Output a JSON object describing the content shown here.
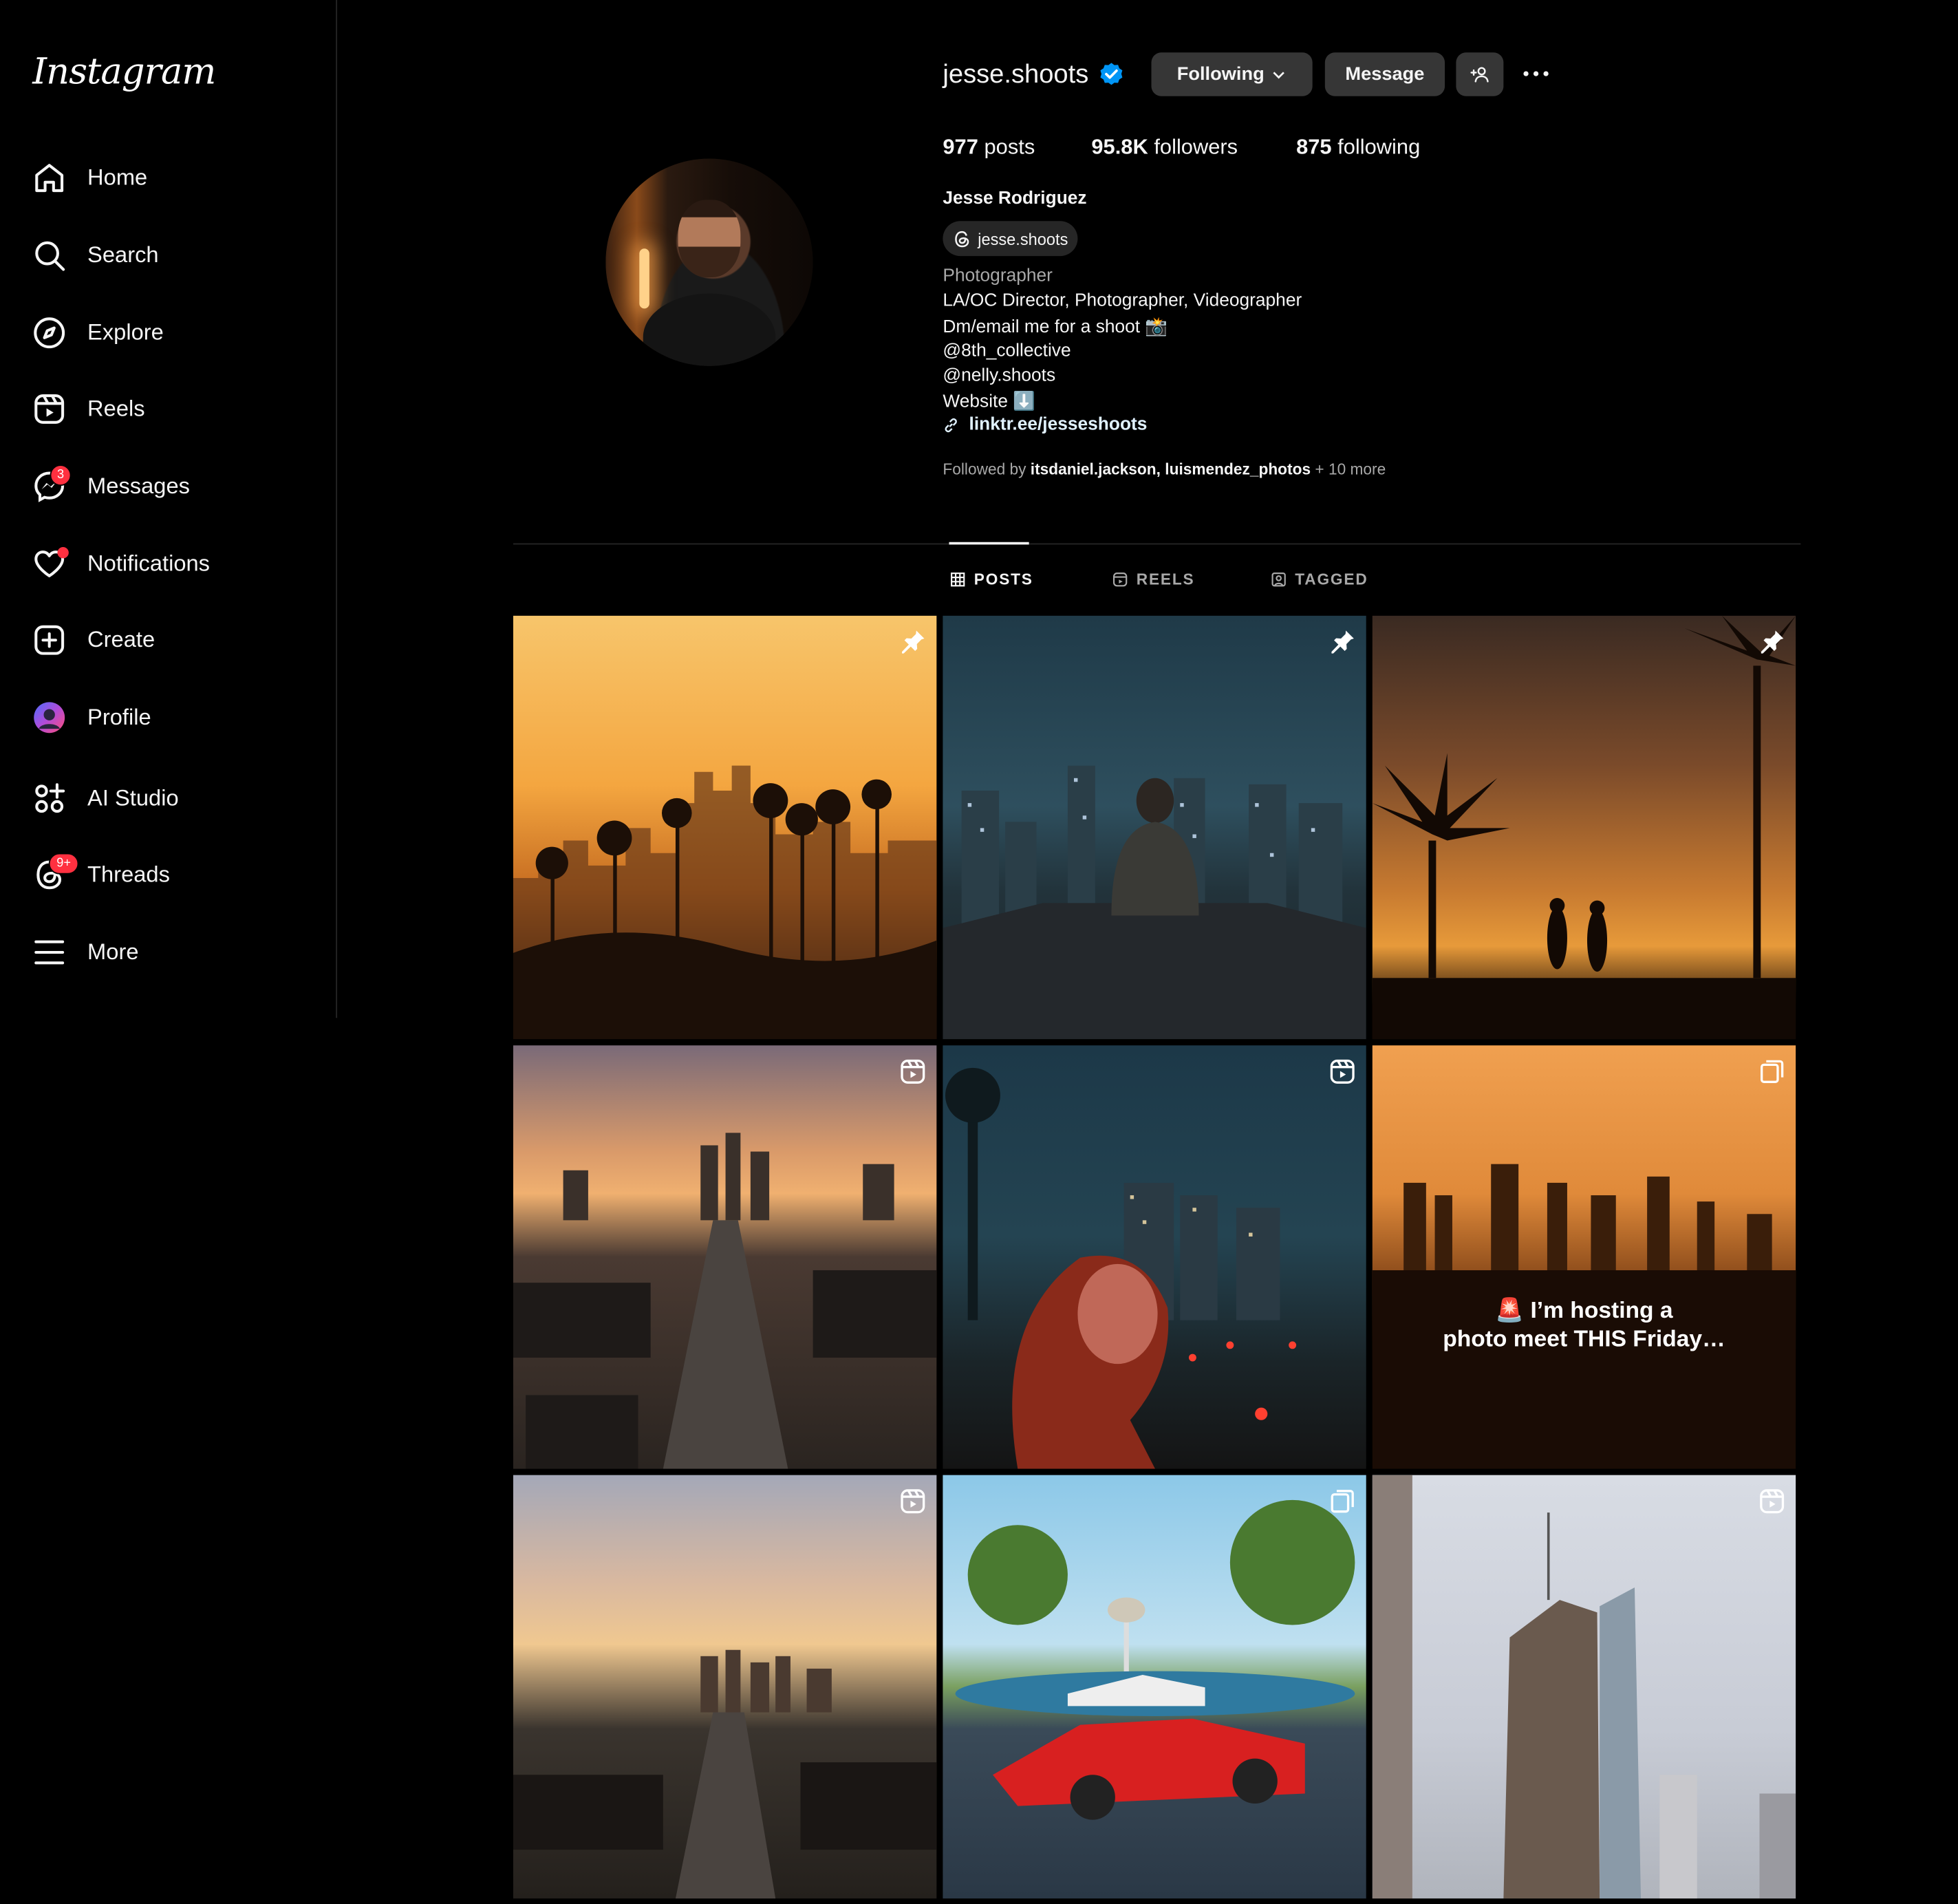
{
  "app": {
    "logo": "Instagram"
  },
  "sidebar": {
    "items": [
      {
        "label": "Home",
        "icon": "home-icon"
      },
      {
        "label": "Search",
        "icon": "search-icon"
      },
      {
        "label": "Explore",
        "icon": "compass-icon"
      },
      {
        "label": "Reels",
        "icon": "reels-icon"
      },
      {
        "label": "Messages",
        "icon": "messenger-icon",
        "badge": "3"
      },
      {
        "label": "Notifications",
        "icon": "heart-icon",
        "dot": true
      },
      {
        "label": "Create",
        "icon": "plus-square-icon"
      },
      {
        "label": "Profile",
        "icon": "avatar-icon"
      },
      {
        "label": "AI Studio",
        "icon": "ai-studio-icon"
      },
      {
        "label": "Threads",
        "icon": "threads-icon",
        "badge": "9+"
      },
      {
        "label": "More",
        "icon": "menu-icon"
      }
    ]
  },
  "profile": {
    "username": "jesse.shoots",
    "verified": true,
    "following_button": "Following",
    "message_button": "Message",
    "stats": {
      "posts_count": "977",
      "posts_label": "posts",
      "followers_count": "95.8K",
      "followers_label": "followers",
      "following_count": "875",
      "following_label": "following"
    },
    "full_name": "Jesse Rodriguez",
    "threads_handle": "jesse.shoots",
    "category": "Photographer",
    "bio": [
      "LA/OC Director, Photographer, Videographer",
      "Dm/email me for a shoot 📸",
      "@8th_collective",
      "@nelly.shoots",
      "Website ⬇️"
    ],
    "link": "linktr.ee/jesseshoots",
    "followed_by_prefix": "Followed by",
    "followed_by_1": "itsdaniel.jackson",
    "followed_by_sep": ",",
    "followed_by_2": "luismendez_photos",
    "followed_by_more": "+ 10 more"
  },
  "tabs": [
    {
      "label": "POSTS",
      "active": true
    },
    {
      "label": "REELS",
      "active": false
    },
    {
      "label": "TAGGED",
      "active": false
    }
  ],
  "posts": [
    {
      "overlay": "pin-icon",
      "scene": "sunset LA skyline with palm trees"
    },
    {
      "overlay": "pin-icon",
      "scene": "man on rooftop overlooking night city"
    },
    {
      "overlay": "pin-icon",
      "scene": "palm tree silhouettes at dusk"
    },
    {
      "overlay": "reel-icon",
      "scene": "aerial boulevard at sunset"
    },
    {
      "overlay": "reel-icon",
      "scene": "woman with city lights at night"
    },
    {
      "overlay": "carousel-icon",
      "caption_line1": "🚨 I’m hosting a",
      "caption_line2": "photo meet THIS Friday…"
    },
    {
      "overlay": "reel-icon",
      "scene": "aerial street at golden hour"
    },
    {
      "overlay": "carousel-icon",
      "scene": "red sports car on basketball court"
    },
    {
      "overlay": "reel-icon",
      "scene": "downtown skyscrapers"
    }
  ]
}
